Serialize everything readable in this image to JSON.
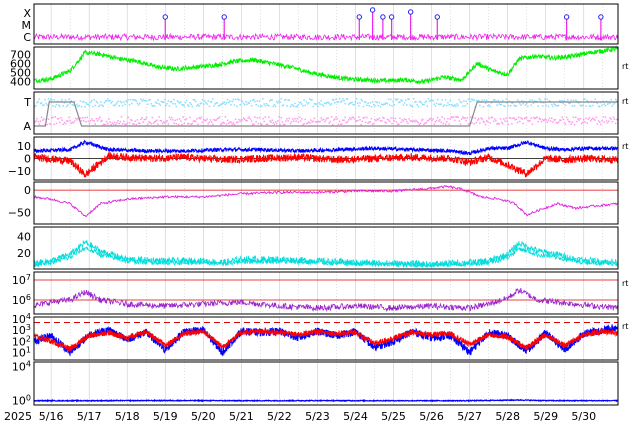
{
  "chart_data": {
    "type": "line",
    "x_axis": {
      "year_label": "2025",
      "tick_labels": [
        "5/16",
        "5/17",
        "5/18",
        "5/19",
        "5/20",
        "5/21",
        "5/22",
        "5/23",
        "5/24",
        "5/25",
        "5/26",
        "5/27",
        "5/28",
        "5/29",
        "5/30"
      ],
      "range_days": [
        15.55,
        30.9
      ]
    },
    "grid": true,
    "panels": [
      {
        "id": "flare-class",
        "type": "event-stem",
        "y_categories": [
          "X",
          "M",
          "C"
        ],
        "color": "#ee22ee",
        "marker_color": "#2222ee",
        "events": [
          {
            "day": 19.0,
            "cls": "M"
          },
          {
            "day": 20.55,
            "cls": "M"
          },
          {
            "day": 24.1,
            "cls": "M"
          },
          {
            "day": 24.45,
            "cls": "X"
          },
          {
            "day": 24.72,
            "cls": "M"
          },
          {
            "day": 24.95,
            "cls": "M"
          },
          {
            "day": 25.45,
            "cls": "M+"
          },
          {
            "day": 26.15,
            "cls": "M"
          },
          {
            "day": 29.55,
            "cls": "M"
          },
          {
            "day": 30.45,
            "cls": "M"
          }
        ]
      },
      {
        "id": "solar-wind-speed",
        "type": "line",
        "y_ticks": [
          400,
          500,
          600,
          700
        ],
        "ylim": [
          320,
          780
        ],
        "color": "#00ee00",
        "right_marker": "rt",
        "series": [
          {
            "x": [
              15.55,
              16.0,
              16.5,
              16.9,
              17.3,
              17.8,
              18.3,
              18.8,
              19.3,
              19.8,
              20.3,
              20.8,
              21.3,
              21.8,
              22.3,
              22.8,
              23.3,
              23.8,
              24.3,
              24.8,
              25.3,
              25.8,
              26.3,
              26.8,
              27.2,
              27.6,
              28.0,
              28.3,
              28.7,
              29.2,
              29.7,
              30.2,
              30.9
            ],
            "y": [
              410,
              430,
              520,
              720,
              700,
              650,
              620,
              560,
              540,
              560,
              580,
              620,
              640,
              600,
              560,
              500,
              460,
              430,
              420,
              410,
              420,
              400,
              450,
              420,
              600,
              520,
              480,
              650,
              680,
              660,
              680,
              720,
              760
            ]
          }
        ]
      },
      {
        "id": "imf-sector",
        "type": "line",
        "y_categories": [
          "T",
          "A"
        ],
        "colors": [
          "#88ddff",
          "#ff99ee",
          "#888888"
        ],
        "right_marker": "rt",
        "sector_path": [
          [
            15.55,
            "A"
          ],
          [
            15.85,
            "A"
          ],
          [
            15.95,
            "T"
          ],
          [
            16.6,
            "T"
          ],
          [
            16.8,
            "A"
          ],
          [
            27.0,
            "A"
          ],
          [
            27.2,
            "T"
          ],
          [
            30.9,
            "T"
          ]
        ]
      },
      {
        "id": "imf-components",
        "type": "line",
        "y_ticks": [
          -10,
          0,
          10
        ],
        "ylim": [
          -17,
          17
        ],
        "right_marker": "rt",
        "series": [
          {
            "color": "#0000ff",
            "x": [
              15.55,
              16.5,
              16.9,
              17.5,
              18.5,
              19.5,
              20.5,
              21.5,
              22.5,
              23.5,
              24.5,
              25.5,
              26.5,
              27.0,
              27.5,
              28.0,
              28.5,
              29.0,
              29.5,
              30.0,
              30.9
            ],
            "y": [
              6,
              7,
              13,
              7,
              6,
              6,
              7,
              7,
              6,
              7,
              8,
              7,
              6,
              4,
              8,
              8,
              13,
              8,
              7,
              8,
              8
            ]
          },
          {
            "color": "#ff0000",
            "x": [
              15.55,
              16.5,
              16.9,
              17.5,
              18.5,
              19.5,
              20.5,
              21.5,
              22.5,
              23.5,
              24.5,
              25.5,
              26.5,
              27.0,
              27.5,
              28.0,
              28.5,
              29.0,
              29.5,
              30.0,
              30.9
            ],
            "y": [
              1,
              -2,
              -13,
              2,
              0,
              1,
              -1,
              0,
              1,
              -1,
              0,
              1,
              0,
              -3,
              1,
              -5,
              -12,
              0,
              -1,
              0,
              -1
            ]
          }
        ]
      },
      {
        "id": "bz-index",
        "type": "line",
        "y_ticks": [
          -50,
          0
        ],
        "ylim": [
          -75,
          18
        ],
        "color": "#dd22dd",
        "ref_line": 0,
        "series": [
          {
            "x": [
              15.55,
              16.0,
              16.5,
              16.9,
              17.3,
              18.0,
              19.0,
              20.0,
              21.0,
              22.0,
              23.0,
              24.0,
              25.0,
              26.0,
              26.4,
              26.8,
              27.3,
              27.8,
              28.2,
              28.5,
              28.8,
              29.3,
              29.8,
              30.3,
              30.9
            ],
            "y": [
              -15,
              -20,
              -30,
              -58,
              -30,
              -20,
              -15,
              -15,
              -8,
              -5,
              -5,
              -2,
              -2,
              4,
              8,
              2,
              -15,
              -20,
              -30,
              -55,
              -45,
              -30,
              -40,
              -35,
              -30
            ]
          }
        ]
      },
      {
        "id": "kp-index",
        "type": "line",
        "y_ticks": [
          20,
          40
        ],
        "ylim": [
          0,
          52
        ],
        "color": "#00dddd",
        "series": [
          {
            "x": [
              15.55,
              16.0,
              16.5,
              16.9,
              17.3,
              18.0,
              19.0,
              20.0,
              20.5,
              21.0,
              22.0,
              23.0,
              24.0,
              25.0,
              26.0,
              27.0,
              27.5,
              28.0,
              28.3,
              28.8,
              29.3,
              29.8,
              30.3,
              30.9
            ],
            "y": [
              7,
              10,
              18,
              33,
              22,
              12,
              10,
              10,
              8,
              12,
              12,
              10,
              8,
              7,
              6,
              8,
              10,
              18,
              32,
              22,
              18,
              12,
              10,
              8
            ]
          }
        ]
      },
      {
        "id": "electron-flux",
        "type": "line",
        "scale": "log",
        "y_ticks": [
          1000000,
          10000000
        ],
        "tick_labels": [
          "10^6",
          "10^7"
        ],
        "ylim_log10": [
          5.3,
          7.4
        ],
        "color": "#9922cc",
        "right_marker": "rt",
        "ref_lines_log10": [
          7.0,
          6.0
        ],
        "series": [
          {
            "x": [
              15.55,
              16.0,
              16.5,
              16.9,
              17.3,
              18.0,
              19.0,
              20.0,
              21.0,
              22.0,
              23.0,
              24.0,
              25.0,
              26.0,
              27.0,
              27.5,
              28.0,
              28.3,
              28.8,
              29.3,
              29.8,
              30.3,
              30.9
            ],
            "y_log10": [
              5.7,
              5.9,
              6.0,
              6.4,
              6.0,
              5.8,
              5.7,
              5.8,
              5.9,
              5.7,
              5.6,
              5.7,
              5.6,
              5.7,
              5.6,
              5.8,
              6.1,
              6.5,
              6.0,
              5.9,
              5.8,
              5.7,
              5.6
            ]
          }
        ]
      },
      {
        "id": "proton-flux",
        "type": "line",
        "scale": "log",
        "tick_labels": [
          "10^1",
          "10^2",
          "10^3",
          "10^4"
        ],
        "ylim_log10": [
          0.3,
          4.2
        ],
        "right_marker": "rt",
        "dashed_ref_log10": 3.7,
        "series": [
          {
            "color": "#0000ff",
            "x": [
              15.55,
              16.0,
              16.5,
              17.0,
              17.5,
              18.0,
              18.5,
              19.0,
              19.5,
              20.0,
              20.5,
              21.0,
              21.5,
              22.0,
              22.5,
              23.0,
              23.5,
              24.0,
              24.5,
              25.0,
              25.5,
              26.0,
              26.5,
              27.0,
              27.5,
              28.0,
              28.5,
              29.0,
              29.5,
              30.0,
              30.5,
              30.9
            ],
            "y_log10": [
              2.0,
              2.5,
              1.0,
              2.6,
              3.0,
              2.2,
              2.8,
              1.2,
              2.9,
              3.0,
              1.0,
              2.9,
              2.8,
              2.9,
              2.3,
              2.9,
              2.5,
              2.9,
              1.4,
              2.0,
              2.9,
              2.3,
              2.5,
              1.0,
              2.8,
              2.5,
              1.1,
              2.8,
              1.2,
              2.7,
              3.0,
              3.3
            ]
          },
          {
            "color": "#ff0000",
            "x": [
              15.55,
              16.0,
              16.5,
              17.0,
              17.5,
              18.0,
              18.5,
              19.0,
              19.5,
              20.0,
              20.5,
              21.0,
              21.5,
              22.0,
              22.5,
              23.0,
              23.5,
              24.0,
              24.5,
              25.0,
              25.5,
              26.0,
              26.5,
              27.0,
              27.5,
              28.0,
              28.5,
              29.0,
              29.5,
              30.0,
              30.5,
              30.9
            ],
            "y_log10": [
              2.5,
              2.0,
              1.3,
              2.5,
              2.8,
              2.3,
              2.9,
              1.6,
              2.7,
              2.9,
              1.5,
              2.8,
              2.9,
              2.8,
              2.6,
              2.9,
              2.7,
              2.8,
              1.8,
              2.3,
              2.8,
              2.6,
              2.7,
              1.7,
              2.6,
              2.4,
              1.4,
              2.6,
              1.6,
              2.6,
              2.9,
              2.7
            ]
          }
        ]
      },
      {
        "id": "xray-flux",
        "type": "line",
        "scale": "log",
        "tick_labels": [
          "10^0",
          "10^4"
        ],
        "ylim_log10": [
          -0.5,
          4.5
        ],
        "color": "#0000ff",
        "series": [
          {
            "x": [
              15.55,
              17.0,
              19.0,
              21.0,
              23.0,
              25.0,
              27.0,
              28.3,
              29.0,
              30.9
            ],
            "y_log10": [
              0.0,
              0.0,
              0.02,
              0.0,
              0.01,
              0.0,
              0.0,
              0.08,
              0.01,
              0.0
            ]
          }
        ]
      }
    ]
  }
}
